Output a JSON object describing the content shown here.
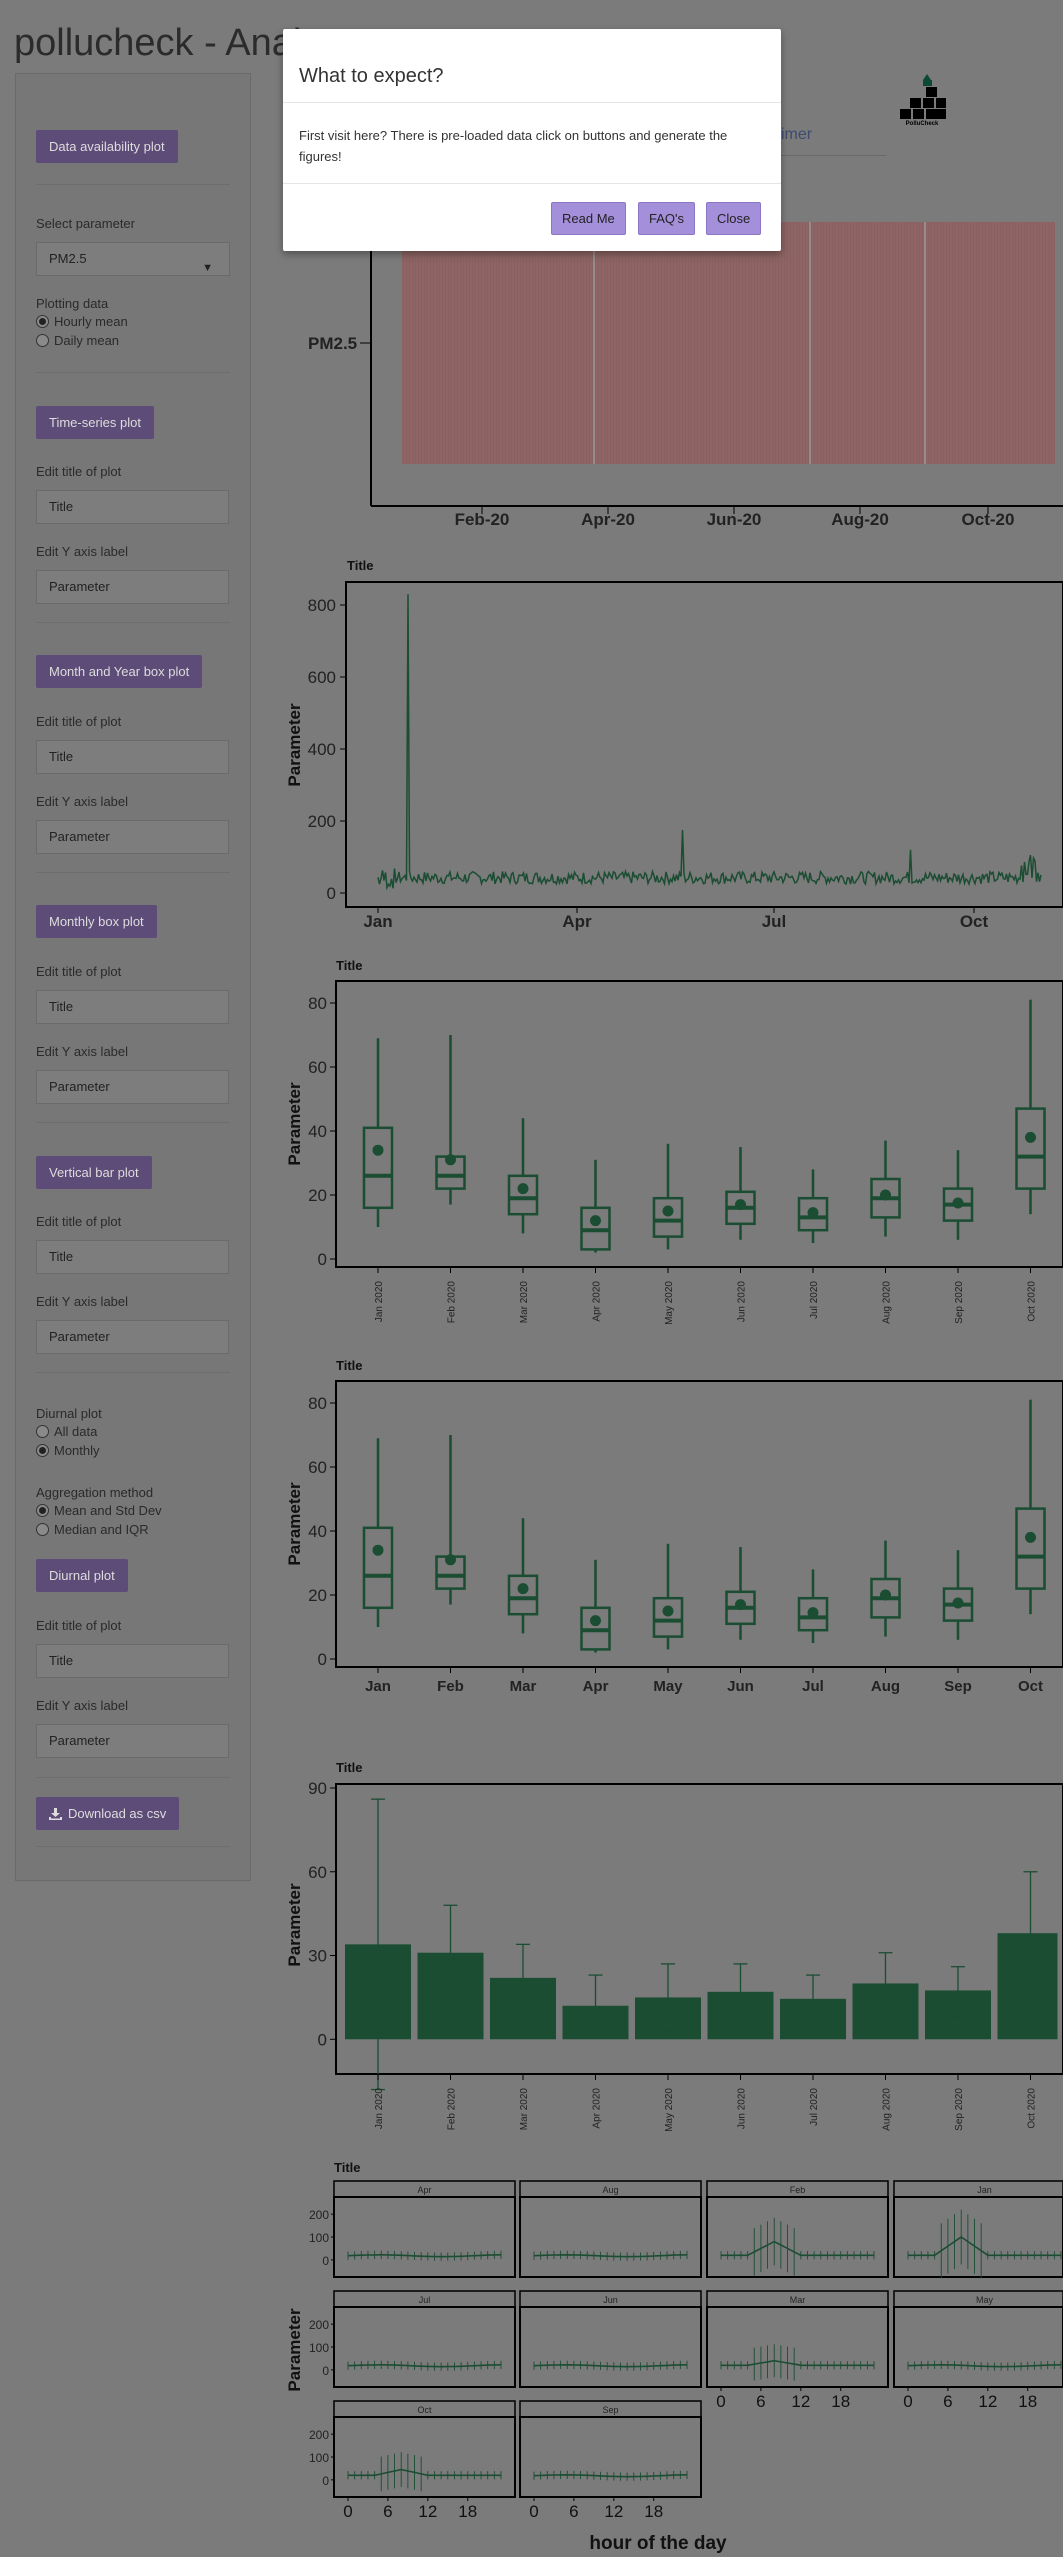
{
  "app": {
    "title": "pollucheck - Anal"
  },
  "header": {
    "tab_partial": "imer",
    "logo_text": "PolluCheck"
  },
  "sidebar": {
    "availability_button": "Data availability plot",
    "select_parameter_label": "Select parameter",
    "parameter_value": "PM2.5",
    "plotting_data_label": "Plotting data",
    "plotting_options": [
      "Hourly mean",
      "Daily mean"
    ],
    "timeseries_button": "Time-series plot",
    "edit_title_label": "Edit title of plot",
    "title_placeholder": "Title",
    "edit_y_label": "Edit Y axis label",
    "y_placeholder": "Parameter",
    "month_year_box_button": "Month and Year box plot",
    "monthly_box_button": "Monthly box plot",
    "vertical_bar_button": "Vertical bar plot",
    "diurnal_plot_label": "Diurnal plot",
    "diurnal_options": [
      "All data",
      "Monthly"
    ],
    "aggregation_label": "Aggregation method",
    "aggregation_options": [
      "Mean and Std Dev",
      "Median and IQR"
    ],
    "diurnal_button": "Diurnal plot",
    "download_button": "Download as csv"
  },
  "modal": {
    "title": "What to expect?",
    "body": "First visit here? There is pre-loaded data click on buttons and generate the figures!",
    "read_me": "Read Me",
    "faqs": "FAQ's",
    "close": "Close"
  },
  "colors": {
    "accent_button": "#5d4b78",
    "modal_button": "#a48fdb",
    "series": "#1b4d33",
    "availability_bar": "#8a6060"
  },
  "chart_data": [
    {
      "type": "bar",
      "name": "availability",
      "ylabel": "PM2.5",
      "x_ticks": [
        "Feb-20",
        "Apr-20",
        "Jun-20",
        "Aug-20",
        "Oct-20"
      ]
    },
    {
      "type": "line",
      "name": "timeseries",
      "title": "Title",
      "ylabel": "Parameter",
      "yticks": [
        0,
        200,
        400,
        600,
        800
      ],
      "x_ticks": [
        "Jan",
        "Apr",
        "Jul",
        "Oct"
      ],
      "ylim": [
        0,
        850
      ],
      "peak": 830
    },
    {
      "type": "box",
      "name": "month_year_box",
      "title": "Title",
      "ylabel": "Parameter",
      "yticks": [
        0,
        20,
        40,
        60,
        80
      ],
      "ylim": [
        0,
        85
      ],
      "categories": [
        "Jan 2020",
        "Feb 2020",
        "Mar 2020",
        "Apr 2020",
        "May 2020",
        "Jun 2020",
        "Jul 2020",
        "Aug 2020",
        "Sep 2020",
        "Oct 2020"
      ],
      "whisker_low": [
        10,
        17,
        8,
        2,
        3,
        6,
        5,
        7,
        6,
        14
      ],
      "q1": [
        16,
        22,
        14,
        3,
        7,
        11,
        9,
        13,
        12,
        22
      ],
      "median": [
        26,
        26,
        19,
        9,
        12,
        16,
        13,
        19,
        17,
        32
      ],
      "q3": [
        41,
        32,
        26,
        16,
        19,
        21,
        19,
        25,
        22,
        47
      ],
      "whisker_high": [
        69,
        70,
        44,
        31,
        36,
        35,
        28,
        37,
        34,
        81
      ],
      "mean": [
        34,
        31,
        22,
        12,
        15,
        17,
        14.5,
        20,
        17.5,
        38
      ]
    },
    {
      "type": "box",
      "name": "monthly_box",
      "title": "Title",
      "ylabel": "Parameter",
      "yticks": [
        0,
        20,
        40,
        60,
        80
      ],
      "ylim": [
        0,
        85
      ],
      "categories": [
        "Jan",
        "Feb",
        "Mar",
        "Apr",
        "May",
        "Jun",
        "Jul",
        "Aug",
        "Sep",
        "Oct"
      ],
      "whisker_low": [
        10,
        17,
        8,
        2,
        3,
        6,
        5,
        7,
        6,
        14
      ],
      "q1": [
        16,
        22,
        14,
        3,
        7,
        11,
        9,
        13,
        12,
        22
      ],
      "median": [
        26,
        26,
        19,
        9,
        12,
        16,
        13,
        19,
        17,
        32
      ],
      "q3": [
        41,
        32,
        26,
        16,
        19,
        21,
        19,
        25,
        22,
        47
      ],
      "whisker_high": [
        69,
        70,
        44,
        31,
        36,
        35,
        28,
        37,
        34,
        81
      ],
      "mean": [
        34,
        31,
        22,
        12,
        15,
        17,
        14.5,
        20,
        17.5,
        38
      ]
    },
    {
      "type": "bar",
      "name": "vertical_bar",
      "title": "Title",
      "ylabel": "Parameter",
      "yticks": [
        0,
        30,
        60,
        90
      ],
      "ylim": [
        -11,
        90
      ],
      "categories": [
        "Jan 2020",
        "Feb 2020",
        "Mar 2020",
        "Apr 2020",
        "May 2020",
        "Jun 2020",
        "Jul 2020",
        "Aug 2020",
        "Sep 2020",
        "Oct 2020"
      ],
      "values": [
        34,
        31,
        22,
        12,
        15,
        17,
        14.5,
        20,
        17.5,
        38
      ],
      "err_low": [
        -18,
        14,
        10,
        1,
        3,
        7,
        6,
        9,
        8,
        16
      ],
      "err_high": [
        86,
        48,
        34,
        23,
        27,
        27,
        23,
        31,
        26,
        60
      ]
    },
    {
      "type": "line",
      "name": "diurnal",
      "title": "Title",
      "ylabel": "Parameter",
      "xlabel": "hour of the day",
      "yticks": [
        0,
        100,
        200
      ],
      "x_ticks": [
        0,
        6,
        12,
        18
      ],
      "ylim": [
        -40,
        240
      ],
      "panels": [
        "Apr",
        "Aug",
        "Feb",
        "Jan",
        "Jul",
        "Jun",
        "Mar",
        "May",
        "Oct",
        "Sep"
      ],
      "panel_peak": [
        15,
        20,
        80,
        100,
        15,
        15,
        40,
        20,
        45,
        20
      ]
    }
  ]
}
